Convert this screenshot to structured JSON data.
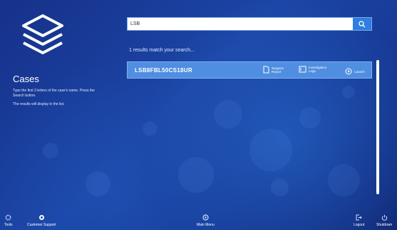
{
  "sidebar": {
    "title": "Cases",
    "help_line1": "Type the first 3 letters of the case's name. Press the Search button.",
    "help_line2": "The results will display in the list."
  },
  "search": {
    "value": "LSB",
    "icon": "search-icon"
  },
  "results": {
    "count_text": "1 results match your search...",
    "items": [
      {
        "id": "LSB8FBL50CS18UR",
        "actions": [
          {
            "label": "Surgeon Report",
            "icon": "document-icon"
          },
          {
            "label": "Investigation Logs",
            "icon": "image-icon"
          },
          {
            "label": "Launch",
            "icon": "play-icon"
          }
        ]
      }
    ]
  },
  "footer": {
    "tools": "Tools",
    "support": "Customer Support",
    "main_menu": "Main Menu",
    "logout": "Logout",
    "shutdown": "Shutdown"
  },
  "colors": {
    "background": "#1c45a6",
    "row": "#4f8ee0",
    "search_button": "#2f7fe0"
  }
}
